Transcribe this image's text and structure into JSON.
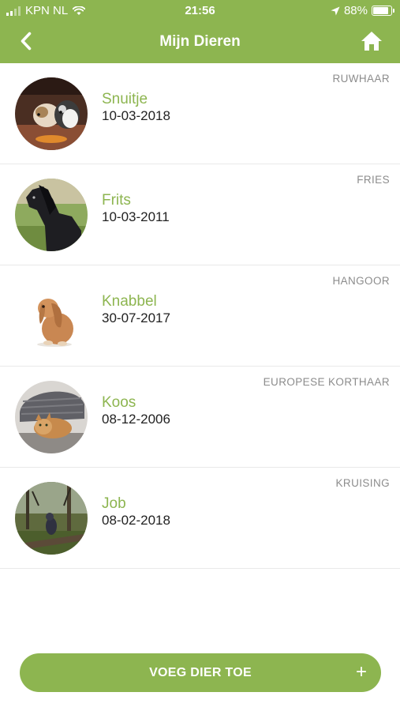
{
  "status_bar": {
    "carrier": "KPN NL",
    "time": "21:56",
    "battery": "88%",
    "battery_level": 0.88,
    "icons": [
      "signal-icon",
      "wifi-icon",
      "location-arrow-icon",
      "battery-icon"
    ]
  },
  "nav": {
    "title": "Mijn Dieren",
    "back_icon": "chevron-left-icon",
    "home_icon": "home-icon"
  },
  "pets": [
    {
      "name": "Snuitje",
      "date": "10-03-2018",
      "breed": "RUWHAAR"
    },
    {
      "name": "Frits",
      "date": "10-03-2011",
      "breed": "FRIES"
    },
    {
      "name": "Knabbel",
      "date": "30-07-2017",
      "breed": "HANGOOR"
    },
    {
      "name": "Koos",
      "date": "08-12-2006",
      "breed": "EUROPESE KORTHAAR"
    },
    {
      "name": "Job",
      "date": "08-02-2018",
      "breed": "KRUISING"
    }
  ],
  "add_button": {
    "label": "VOEG DIER TOE",
    "icon": "plus-icon"
  },
  "colors": {
    "brand_green": "#8db550",
    "breed_gray": "#8c8c8c",
    "text_dark": "#222222"
  }
}
